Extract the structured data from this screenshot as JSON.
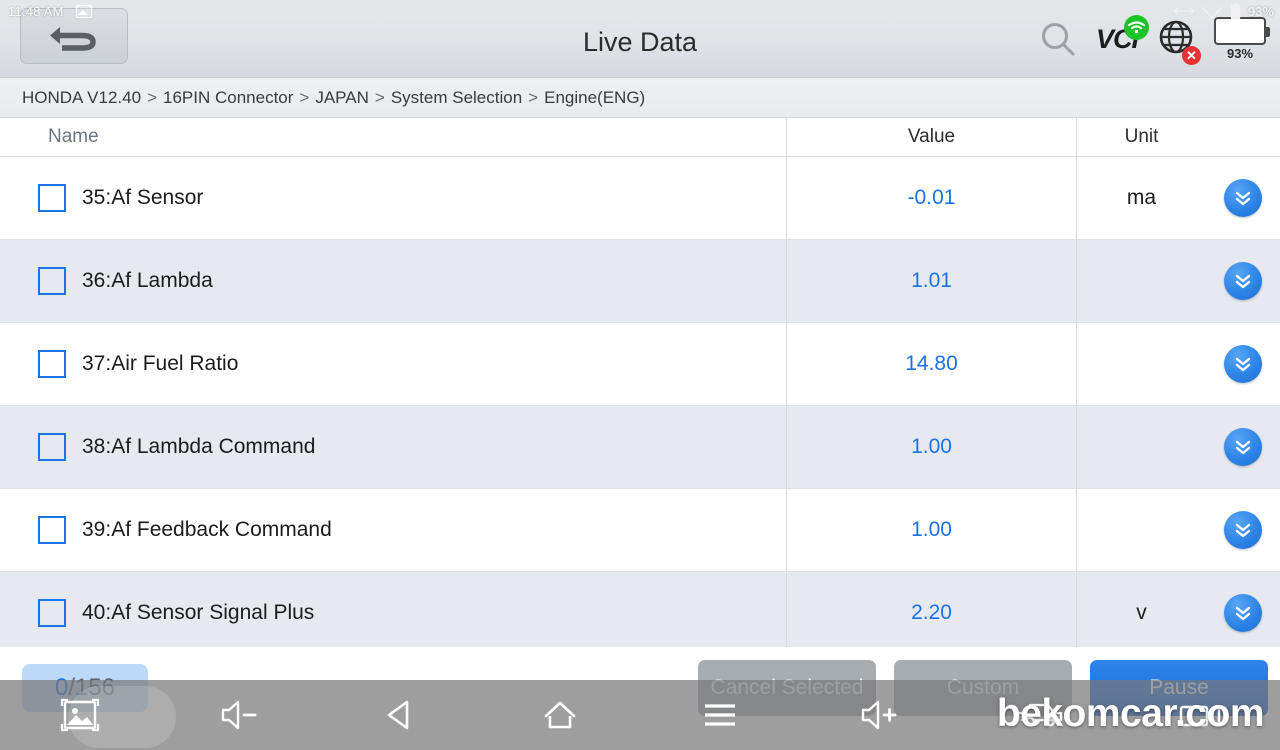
{
  "statusbar": {
    "time": "11:48 AM",
    "screenshot_icon": "image-icon",
    "resize_icon": "resize-arrows-icon",
    "wifi_icon": "wifi-signal-icon",
    "battery_icon": "battery-icon",
    "battery_percent_small": "93%"
  },
  "header": {
    "title": "Live Data",
    "back_icon": "back-arrow-icon",
    "search_icon": "search-icon",
    "vci_label": "VCI",
    "vci_wifi_icon": "wifi-icon",
    "globe_icon": "globe-icon",
    "globe_error_mark": "✕",
    "battery_percent": "93%",
    "battery_level": 93
  },
  "breadcrumb": {
    "separator": ">",
    "items": [
      "HONDA V12.40",
      "16PIN Connector",
      "JAPAN",
      "System Selection",
      "Engine(ENG)"
    ]
  },
  "table": {
    "columns": {
      "name": "Name",
      "value": "Value",
      "unit": "Unit"
    },
    "expand_icon": "chevron-double-down-icon",
    "rows": [
      {
        "name": "35:Af Sensor",
        "value": "-0.01",
        "unit": "ma",
        "checked": false
      },
      {
        "name": "36:Af Lambda",
        "value": "1.01",
        "unit": "",
        "checked": false
      },
      {
        "name": "37:Air Fuel Ratio",
        "value": "14.80",
        "unit": "",
        "checked": false
      },
      {
        "name": "38:Af Lambda Command",
        "value": "1.00",
        "unit": "",
        "checked": false
      },
      {
        "name": "39:Af Feedback Command",
        "value": "1.00",
        "unit": "",
        "checked": false
      },
      {
        "name": "40:Af Sensor Signal Plus",
        "value": "2.20",
        "unit": "v",
        "checked": false
      }
    ]
  },
  "footer": {
    "counter_current": "0",
    "counter_total": "/156",
    "buttons": [
      {
        "label": "Cancel Selected",
        "style": "grey"
      },
      {
        "label": "Custom",
        "style": "grey"
      },
      {
        "label": "Pause",
        "style": "blue"
      }
    ]
  },
  "navbar": {
    "screenshot_icon": "screenshot-image-icon",
    "volume_down_icon": "volume-down-icon",
    "back_icon": "nav-back-triangle-icon",
    "home_icon": "nav-home-icon",
    "recents_icon": "nav-menu-icon",
    "volume_up_icon": "volume-up-icon",
    "car_icon": "car-icon",
    "video_icon": "video-camera-icon"
  },
  "watermark": {
    "text": "bekomcar.com"
  },
  "colors": {
    "accent_blue": "#1a73e8",
    "row_alt": "#e6eaf0",
    "header_grey": "#dfe3e7",
    "button_grey": "#a7acb1"
  }
}
